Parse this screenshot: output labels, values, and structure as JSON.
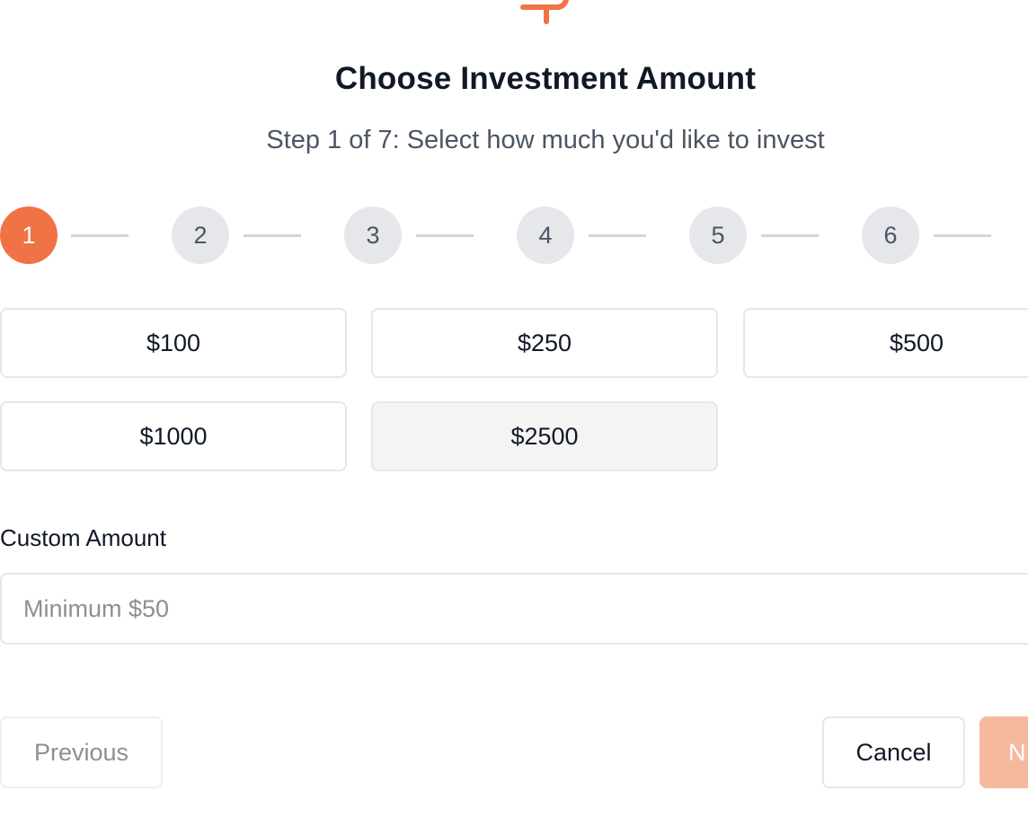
{
  "header": {
    "title": "Choose Investment Amount",
    "subtitle": "Step 1 of 7: Select how much you'd like to invest"
  },
  "stepper": {
    "current_step": 1,
    "total_steps": 7,
    "steps": [
      "1",
      "2",
      "3",
      "4",
      "5",
      "6"
    ],
    "active_color": "#f07345",
    "inactive_color": "#e5e7eb"
  },
  "amount_options": [
    "$100",
    "$250",
    "$500",
    "$1000",
    "$2500"
  ],
  "selected_amount": "$2500",
  "custom": {
    "label": "Custom Amount",
    "placeholder": "Minimum $50",
    "value": ""
  },
  "footer": {
    "previous_label": "Previous",
    "cancel_label": "Cancel",
    "next_label": "N"
  },
  "colors": {
    "accent": "#f07345",
    "next_disabled_bg": "#f7b8a0"
  },
  "icons": {
    "logo": "brand-logo-icon"
  }
}
